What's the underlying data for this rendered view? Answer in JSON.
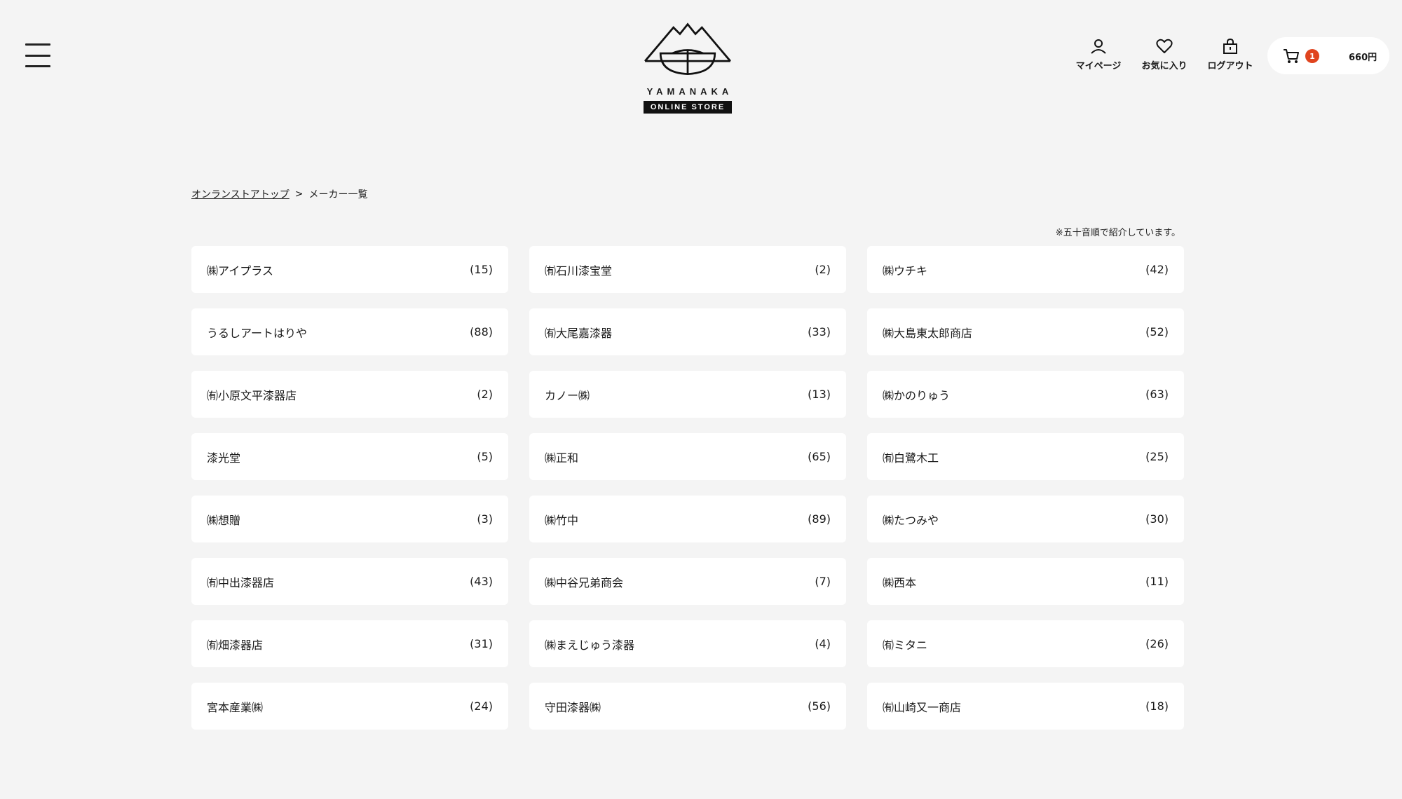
{
  "header": {
    "logo": {
      "wordmark": "YAMANAKA",
      "tagline": "ONLINE STORE"
    },
    "nav": [
      {
        "label": "マイページ",
        "icon": "user-icon"
      },
      {
        "label": "お気に入り",
        "icon": "heart-icon"
      },
      {
        "label": "ログアウト",
        "icon": "logout-bag-icon"
      }
    ],
    "cart": {
      "count": "1",
      "total": "660円",
      "icon": "cart-icon",
      "badge_color": "#e0441e"
    }
  },
  "breadcrumb": {
    "home": "オンランストアトップ",
    "separator": ">",
    "current": "メーカー一覧"
  },
  "note": "※五十音順で紹介しています。",
  "makers": [
    {
      "name": "㈱アイプラス",
      "count": "(15)"
    },
    {
      "name": "㈲石川漆宝堂",
      "count": "(2)"
    },
    {
      "name": "㈱ウチキ",
      "count": "(42)"
    },
    {
      "name": "うるしアートはりや",
      "count": "(88)"
    },
    {
      "name": "㈲大尾嘉漆器",
      "count": "(33)"
    },
    {
      "name": "㈱大島東太郎商店",
      "count": "(52)"
    },
    {
      "name": "㈲小原文平漆器店",
      "count": "(2)"
    },
    {
      "name": "カノー㈱",
      "count": "(13)"
    },
    {
      "name": "㈱かのりゅう",
      "count": "(63)"
    },
    {
      "name": "漆光堂",
      "count": "(5)"
    },
    {
      "name": "㈱正和",
      "count": "(65)"
    },
    {
      "name": "㈲白鷺木工",
      "count": "(25)"
    },
    {
      "name": "㈱想贈",
      "count": "(3)"
    },
    {
      "name": "㈱竹中",
      "count": "(89)"
    },
    {
      "name": "㈱たつみや",
      "count": "(30)"
    },
    {
      "name": "㈲中出漆器店",
      "count": "(43)"
    },
    {
      "name": "㈱中谷兄弟商会",
      "count": "(7)"
    },
    {
      "name": "㈱西本",
      "count": "(11)"
    },
    {
      "name": "㈲畑漆器店",
      "count": "(31)"
    },
    {
      "name": "㈱まえじゅう漆器",
      "count": "(4)"
    },
    {
      "name": "㈲ミタニ",
      "count": "(26)"
    },
    {
      "name": "宮本産業㈱",
      "count": "(24)"
    },
    {
      "name": "守田漆器㈱",
      "count": "(56)"
    },
    {
      "name": "㈲山崎又一商店",
      "count": "(18)"
    }
  ]
}
